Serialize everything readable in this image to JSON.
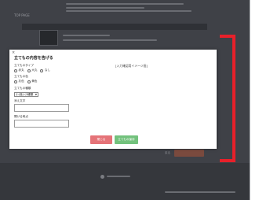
{
  "background": {
    "heading": "TOP PAGE"
  },
  "modal": {
    "title": "立てもの内容を告げる",
    "close_glyph": "×",
    "preview_label": "[入力確認用イメージ画]",
    "type_section": {
      "label": "立てものタイプ",
      "options": [
        "赤丸",
        "大丸",
        "なし"
      ]
    },
    "tail_section": {
      "label": "立てもの色",
      "options": [
        "灰色",
        "黄色"
      ]
    },
    "size_section": {
      "label": "立てもの種類",
      "selected": "小(強)-小種類"
    },
    "field1_label": "添え文字",
    "field2_label": "開ける時点",
    "buttons": {
      "close": "閉じる",
      "save": "立てもの保存"
    }
  },
  "colors": {
    "overlay": "#3f4147",
    "bracket": "#e8202a",
    "close_button": "#e57378",
    "save_button": "#73c27d"
  }
}
